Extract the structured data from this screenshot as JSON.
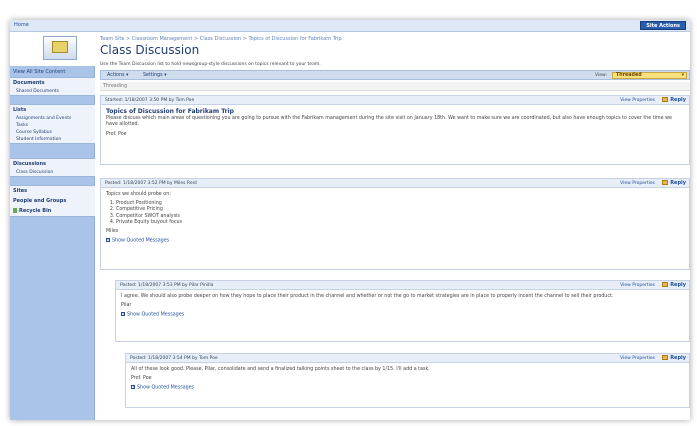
{
  "top": {
    "home": "Home",
    "site_actions": "Site Actions"
  },
  "header": {
    "breadcrumb": "Team Site > Classroom Management > Class Discussion > Topics of Discussion for Fabrikam Trip",
    "title": "Class Discussion",
    "description": "Use the Team Discussion list to hold newsgroup-style discussions on topics relevant to your team."
  },
  "sidebar": {
    "view_all": "View All Site Content",
    "documents_h": "Documents",
    "shared_docs": "Shared Documents",
    "lists_h": "Lists",
    "assignments": "Assignments and Events",
    "tasks": "Tasks",
    "syllabus": "Course Syllabus",
    "student_info": "Student Information",
    "discussions_h": "Discussions",
    "class_discussion": "Class Discussion",
    "sites_h": "Sites",
    "people_h": "People and Groups",
    "recycle": "Recycle Bin"
  },
  "toolbar": {
    "actions": "Actions",
    "settings": "Settings",
    "view_label": "View:",
    "view_value": "Threaded"
  },
  "threading": "Threading",
  "messages": [
    {
      "posted": "Started: 1/18/2007 3:50 PM by Tom Poe",
      "view_props": "View Properties",
      "reply": "Reply",
      "subject": "Topics of Discussion for Fabrikam Trip",
      "body": "Please discuss which main areas of questioning you are going to pursue with the Fabrikam management during the site visit on January 18th. We want to make sure we are coordinated, but also have enough topics to cover the time we have allotted.",
      "sign": "Prof. Poe"
    },
    {
      "posted": "Posted: 1/18/2007 3:52 PM by Miles Reid",
      "view_props": "View Properties",
      "reply": "Reply",
      "intro": "Topics we should probe on:",
      "list": [
        "Product Positioning",
        "Competitive Pricing",
        "Competitor SWOT analysis",
        "Private Equity buyout focus"
      ],
      "sign": "Miles",
      "quoted": "Show Quoted Messages"
    },
    {
      "posted": "Posted: 1/18/2007 3:53 PM by Pilar Pinilla",
      "view_props": "View Properties",
      "reply": "Reply",
      "body": "I agree. We should also probe deeper on how they hope to place their product in the channel and whether or not the go to market strategies are in place to properly incent the channel to sell their product.",
      "sign": "Pilar",
      "quoted": "Show Quoted Messages"
    },
    {
      "posted": "Posted: 1/18/2007 3:54 PM by Tom Poe",
      "view_props": "View Properties",
      "reply": "Reply",
      "body": "All of these look good. Please, Pilar, consolidate and send a finalized talking points sheet to the class by 1/15. I'll add a task.",
      "sign": "Prof. Poe",
      "quoted": "Show Quoted Messages"
    }
  ]
}
